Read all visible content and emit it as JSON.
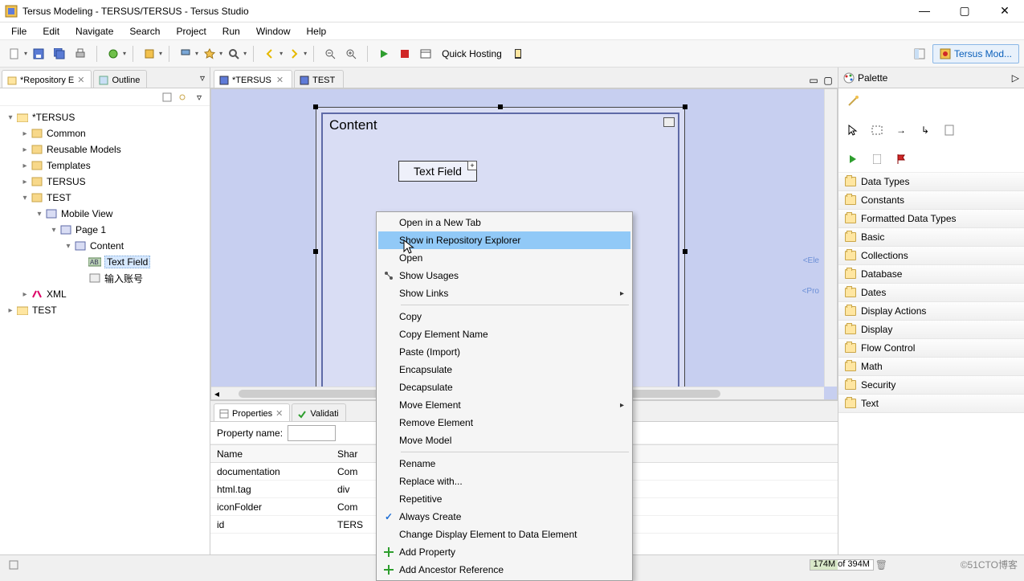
{
  "window": {
    "title": "Tersus Modeling - TERSUS/TERSUS - Tersus Studio",
    "perspective": "Tersus Mod..."
  },
  "menu": [
    "File",
    "Edit",
    "Navigate",
    "Search",
    "Project",
    "Run",
    "Window",
    "Help"
  ],
  "toolbar": {
    "quick_hosting": "Quick Hosting"
  },
  "left": {
    "tab_repo": "*Repository E",
    "tab_outline": "Outline",
    "tree": {
      "root": "*TERSUS",
      "n_common": "Common",
      "n_reusable": "Reusable Models",
      "n_templates": "Templates",
      "n_tersus": "TERSUS",
      "n_test": "TEST",
      "n_mobile": "Mobile View",
      "n_page1": "Page 1",
      "n_content": "Content",
      "n_textfield": "Text Field",
      "n_input_acct": "输入账号",
      "n_xml": "XML",
      "n_test2": "TEST"
    }
  },
  "editor": {
    "tab_tersus": "*TERSUS",
    "tab_test": "TEST",
    "content_title": "Content",
    "text_field": "Text Field",
    "tag_ele": "<Ele",
    "tag_pro": "<Pro"
  },
  "properties": {
    "tab_props": "Properties",
    "tab_valid": "Validati",
    "label_name": "Property name:",
    "head_name": "Name",
    "head_shared": "Shar",
    "rows": [
      {
        "n": "documentation",
        "s": "Com"
      },
      {
        "n": "html.tag",
        "s": "div"
      },
      {
        "n": "iconFolder",
        "s": "Com"
      },
      {
        "n": "id",
        "s": "TERS"
      }
    ]
  },
  "palette": {
    "title": "Palette",
    "items": [
      "Data Types",
      "Constants",
      "Formatted Data Types",
      "Basic",
      "Collections",
      "Database",
      "Dates",
      "Display Actions",
      "Display",
      "Flow Control",
      "Math",
      "Security",
      "Text"
    ]
  },
  "context_menu": {
    "items": [
      {
        "t": "Open in a New Tab"
      },
      {
        "t": "Show in Repository Explorer",
        "hl": true
      },
      {
        "t": "Open"
      },
      {
        "t": "Show Usages",
        "icon": "usages"
      },
      {
        "t": "Show Links",
        "sub": true
      },
      {
        "sep": true
      },
      {
        "t": "Copy"
      },
      {
        "t": "Copy Element Name"
      },
      {
        "t": "Paste (Import)"
      },
      {
        "t": "Encapsulate"
      },
      {
        "t": "Decapsulate"
      },
      {
        "t": "Move Element",
        "sub": true
      },
      {
        "t": "Remove Element"
      },
      {
        "t": "Move Model"
      },
      {
        "sep": true
      },
      {
        "t": "Rename"
      },
      {
        "t": "Replace with..."
      },
      {
        "t": "Repetitive"
      },
      {
        "t": "Always Create",
        "chk": true
      },
      {
        "t": "Change Display Element to Data Element"
      },
      {
        "t": "Add Property",
        "icon": "add"
      },
      {
        "t": "Add Ancestor Reference",
        "icon": "add"
      }
    ]
  },
  "status": {
    "mem_used": "174M",
    "mem_total": " of 394M",
    "watermark": "©51CTO博客"
  }
}
